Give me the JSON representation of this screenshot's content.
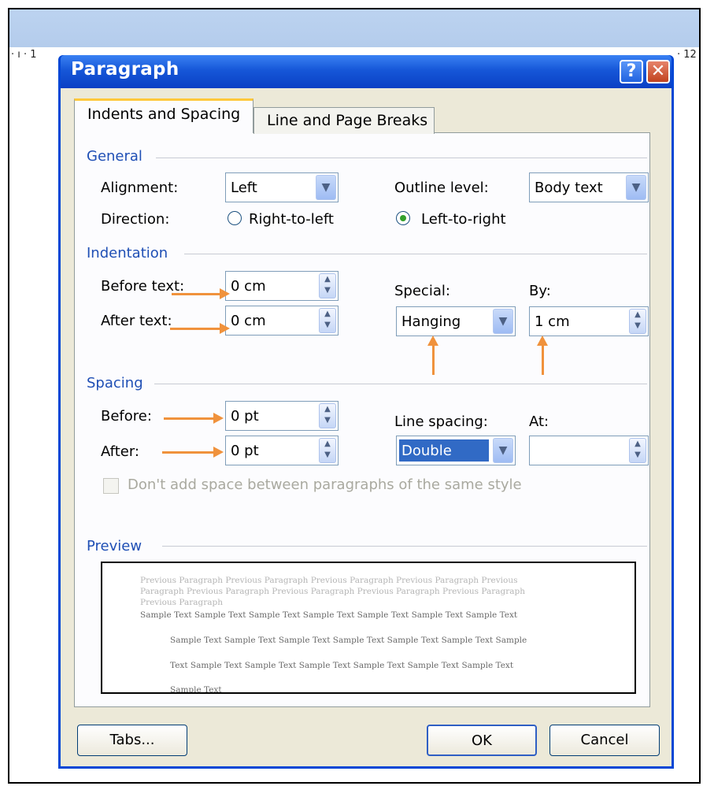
{
  "ruler": {
    "left_marks": "· ı · 1",
    "right_mark": "· 12"
  },
  "dialog": {
    "title": "Paragraph",
    "help_glyph": "?",
    "close_glyph": "✕",
    "tabs": [
      {
        "label": "Indents and Spacing",
        "active": true
      },
      {
        "label": "Line and Page Breaks",
        "active": false
      }
    ],
    "general": {
      "section_label": "General",
      "alignment_label": "Alignment:",
      "alignment_value": "Left",
      "outline_label": "Outline level:",
      "outline_value": "Body text",
      "direction_label": "Direction:",
      "direction_rtl": "Right-to-left",
      "direction_ltr": "Left-to-right",
      "direction_selected": "Left-to-right"
    },
    "indentation": {
      "section_label": "Indentation",
      "before_text_label": "Before text:",
      "before_text_value": "0 cm",
      "after_text_label": "After text:",
      "after_text_value": "0 cm",
      "special_label": "Special:",
      "special_value": "Hanging",
      "by_label": "By:",
      "by_value": "1 cm"
    },
    "spacing": {
      "section_label": "Spacing",
      "before_label": "Before:",
      "before_value": "0 pt",
      "after_label": "After:",
      "after_value": "0 pt",
      "line_spacing_label": "Line spacing:",
      "line_spacing_value": "Double",
      "at_label": "At:",
      "at_value": "",
      "dont_add_space_label": "Don't add space between paragraphs of the same style",
      "dont_add_space_checked": false
    },
    "preview": {
      "section_label": "Preview",
      "previous_lines": [
        "Previous Paragraph Previous Paragraph Previous Paragraph Previous Paragraph Previous",
        "Paragraph Previous Paragraph Previous Paragraph Previous Paragraph Previous Paragraph",
        "Previous Paragraph"
      ],
      "sample_lines": [
        "Sample Text Sample Text Sample Text Sample Text Sample Text Sample Text Sample Text",
        "Sample Text Sample Text Sample Text Sample Text Sample Text Sample Text Sample",
        "Text Sample Text Sample Text Sample Text Sample Text Sample Text Sample Text",
        "Sample Text"
      ]
    },
    "buttons": {
      "tabs": "Tabs...",
      "ok": "OK",
      "cancel": "Cancel"
    }
  },
  "colors": {
    "title_bar": "#0a3fc4",
    "section_header": "#1f4fb5",
    "annotation_arrow": "#f0923c",
    "selection": "#316ac5"
  }
}
